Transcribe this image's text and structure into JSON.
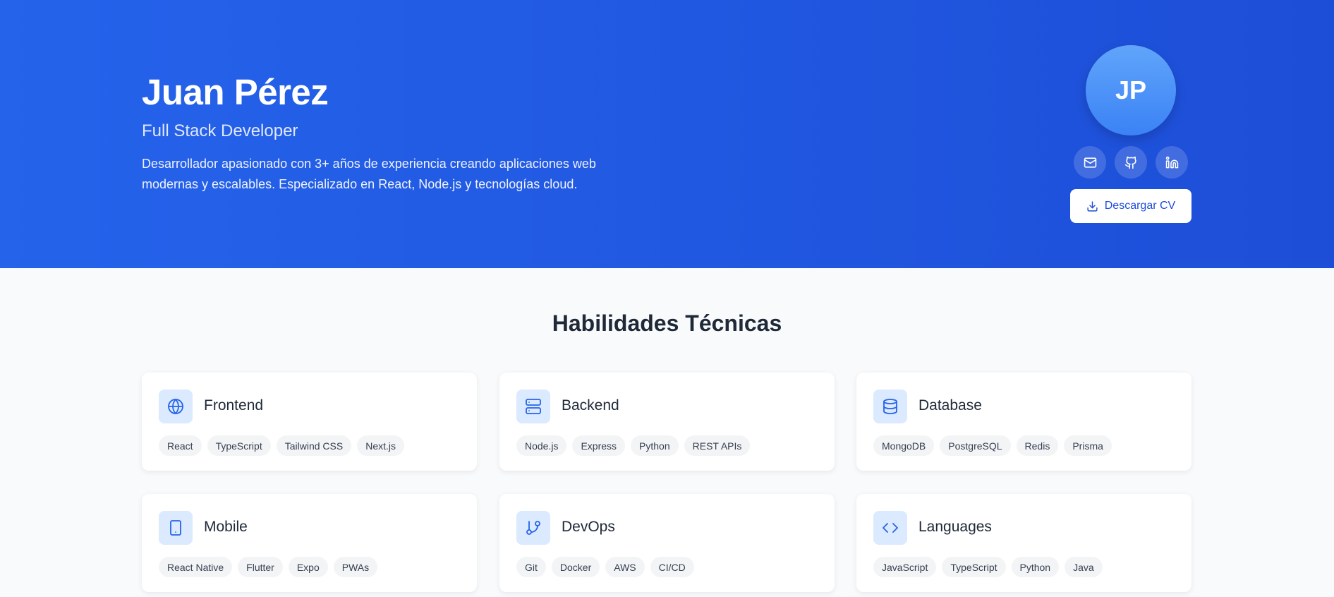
{
  "profile": {
    "name": "Juan Pérez",
    "role": "Full Stack Developer",
    "bio_line1": "Desarrollador apasionado con 3+ años de experiencia creando aplicaciones web",
    "bio_line2": "modernas y escalables. Especializado en React, Node.js y tecnologías cloud.",
    "initials": "JP"
  },
  "social": {
    "email_icon": "mail-icon",
    "github_icon": "github-icon",
    "linkedin_icon": "linkedin-icon"
  },
  "cv_button": {
    "label": "Descargar CV",
    "icon": "download-icon"
  },
  "skills": {
    "title": "Habilidades Técnicas",
    "categories": [
      {
        "name": "Frontend",
        "icon": "globe-icon",
        "tags": [
          "React",
          "TypeScript",
          "Tailwind CSS",
          "Next.js"
        ]
      },
      {
        "name": "Backend",
        "icon": "server-icon",
        "tags": [
          "Node.js",
          "Express",
          "Python",
          "REST APIs"
        ]
      },
      {
        "name": "Database",
        "icon": "database-icon",
        "tags": [
          "MongoDB",
          "PostgreSQL",
          "Redis",
          "Prisma"
        ]
      },
      {
        "name": "Mobile",
        "icon": "smartphone-icon",
        "tags": [
          "React Native",
          "Flutter",
          "Expo",
          "PWAs"
        ]
      },
      {
        "name": "DevOps",
        "icon": "git-branch-icon",
        "tags": [
          "Git",
          "Docker",
          "AWS",
          "CI/CD"
        ]
      },
      {
        "name": "Languages",
        "icon": "code-icon",
        "tags": [
          "JavaScript",
          "TypeScript",
          "Python",
          "Java"
        ]
      }
    ]
  },
  "colors": {
    "hero_bg": "#2563eb",
    "accent": "#1d4ed8",
    "icon_bg": "#dbeafe",
    "tag_bg": "#f3f4f6"
  }
}
